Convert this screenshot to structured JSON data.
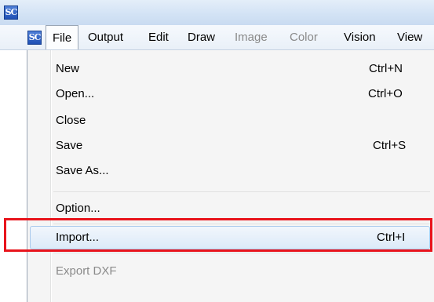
{
  "window": {
    "app_icon_text": "SC"
  },
  "menubar": {
    "app_icon_text": "SC",
    "menus": [
      {
        "label": "File",
        "state": "active"
      },
      {
        "label": "Output",
        "state": "enabled"
      },
      {
        "label": "Edit",
        "state": "enabled"
      },
      {
        "label": "Draw",
        "state": "enabled"
      },
      {
        "label": "Image",
        "state": "disabled"
      },
      {
        "label": "Color",
        "state": "disabled"
      },
      {
        "label": "Vision",
        "state": "enabled"
      },
      {
        "label": "View",
        "state": "enabled"
      }
    ]
  },
  "file_menu": {
    "items": [
      {
        "label": "New",
        "shortcut": "Ctrl+N",
        "enabled": true
      },
      {
        "label": "Open...",
        "shortcut": "Ctrl+O",
        "enabled": true
      },
      {
        "label": "Close",
        "shortcut": "",
        "enabled": true
      },
      {
        "label": "Save",
        "shortcut": "Ctrl+S",
        "enabled": true
      },
      {
        "label": "Save As...",
        "shortcut": "",
        "enabled": true
      },
      {
        "label": "Option...",
        "shortcut": "",
        "enabled": true
      },
      {
        "label": "Import...",
        "shortcut": "Ctrl+I",
        "enabled": true,
        "highlighted": true
      },
      {
        "label": "Export DXF",
        "shortcut": "",
        "enabled": false
      }
    ]
  },
  "annotation": {
    "color": "#e8141c",
    "target": "Import..."
  },
  "colors": {
    "highlight_border": "#a9c9ec",
    "disabled_text": "#8a8a8a"
  }
}
